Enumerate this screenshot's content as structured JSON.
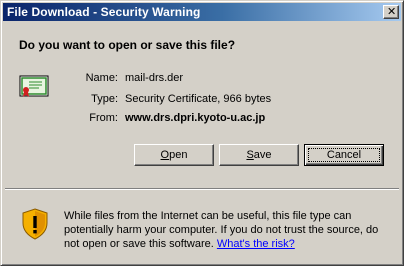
{
  "window": {
    "title": "File Download - Security Warning",
    "close_glyph": "✕"
  },
  "question": "Do you want to open or save this file?",
  "file": {
    "name_label": "Name:",
    "name_value": "mail-drs.der",
    "type_label": "Type:",
    "type_value": "Security Certificate, 966 bytes",
    "from_label": "From:",
    "from_value": "www.drs.dpri.kyoto-u.ac.jp",
    "icon": "certificate-icon"
  },
  "buttons": {
    "open_label": "Open",
    "save_label": "Save",
    "cancel_label": "Cancel"
  },
  "warning": {
    "icon": "shield-warning-icon",
    "text": "While files from the Internet can be useful, this file type can potentially harm your computer. If you do not trust the source, do not open or save this software. ",
    "link_text": "What's the risk?"
  },
  "colors": {
    "titlebar_start": "#0a246a",
    "titlebar_end": "#a6caf0",
    "dialog_bg": "#d4d0c8",
    "link": "#0000ff",
    "shield": "#f0a000"
  }
}
